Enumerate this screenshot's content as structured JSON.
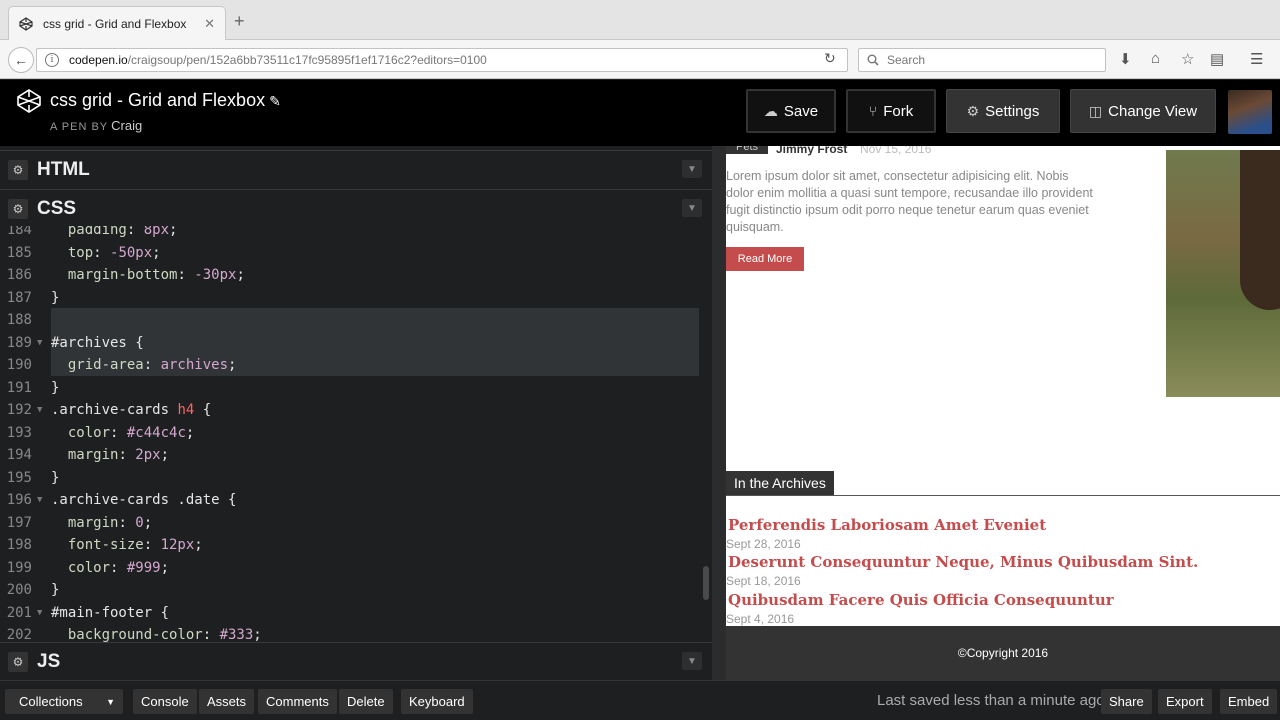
{
  "browser": {
    "tab_title": "css grid - Grid and Flexbox",
    "url_host": "codepen.io",
    "url_path": "/craigsoup/pen/152a6bb73511c17fc95895f1ef1716c2?editors=0100",
    "search_placeholder": "Search"
  },
  "header": {
    "pen_title": "css grid - Grid and Flexbox",
    "pen_by": "A PEN BY",
    "author": "Craig",
    "buttons": {
      "save": "Save",
      "fork": "Fork",
      "settings": "Settings",
      "change_view": "Change View"
    }
  },
  "editor": {
    "panels": {
      "html": "HTML",
      "css": "CSS",
      "js": "JS"
    },
    "code_lines": [
      {
        "n": "184",
        "text": "  padding: 8px;"
      },
      {
        "n": "185",
        "text": "  top: -50px;"
      },
      {
        "n": "186",
        "text": "  margin-bottom: -30px;"
      },
      {
        "n": "187",
        "text": "}"
      },
      {
        "n": "188",
        "text": ""
      },
      {
        "n": "189",
        "text": "#archives {"
      },
      {
        "n": "190",
        "text": "  grid-area: archives;"
      },
      {
        "n": "191",
        "text": "}"
      },
      {
        "n": "192",
        "text": ".archive-cards h4 {"
      },
      {
        "n": "193",
        "text": "  color: #c44c4c;"
      },
      {
        "n": "194",
        "text": "  margin: 2px;"
      },
      {
        "n": "195",
        "text": "}"
      },
      {
        "n": "196",
        "text": ".archive-cards .date {"
      },
      {
        "n": "197",
        "text": "  margin: 0;"
      },
      {
        "n": "198",
        "text": "  font-size: 12px;"
      },
      {
        "n": "199",
        "text": "  color: #999;"
      },
      {
        "n": "200",
        "text": "}"
      },
      {
        "n": "201",
        "text": "#main-footer {"
      },
      {
        "n": "202",
        "text": "  background-color: #333;"
      }
    ]
  },
  "preview": {
    "top_tag": "Pets",
    "top_author": "Jimmy Frost",
    "top_date": "Nov 15, 2016",
    "lorem": "Lorem ipsum dolor sit amet, consectetur adipisicing elit. Nobis dolor enim mollitia a quasi sunt tempore, recusandae illo provident fugit distinctio ipsum odit porro neque tenetur earum quas eveniet quisquam.",
    "read_more": "Read More",
    "archives_heading": "In the Archives",
    "archives": [
      {
        "title": "Perferendis Laboriosam Amet Eveniet",
        "date": "Sept 28, 2016"
      },
      {
        "title": "Deserunt Consequuntur Neque, Minus Quibusdam Sint.",
        "date": "Sept 18, 2016"
      },
      {
        "title": "Quibusdam Facere Quis Officia Consequuntur",
        "date": "Sept 4, 2016"
      }
    ],
    "footer": "©Copyright 2016"
  },
  "bottom_bar": {
    "collections": "Collections",
    "console": "Console",
    "assets": "Assets",
    "comments": "Comments",
    "delete": "Delete",
    "keyboard": "Keyboard",
    "saved_status": "Last saved less than a minute ago",
    "share": "Share",
    "export": "Export",
    "embed": "Embed"
  },
  "colors": {
    "accent_red": "#c44c4c",
    "editor_bg": "#1d1f20",
    "header_bg": "#000000"
  }
}
